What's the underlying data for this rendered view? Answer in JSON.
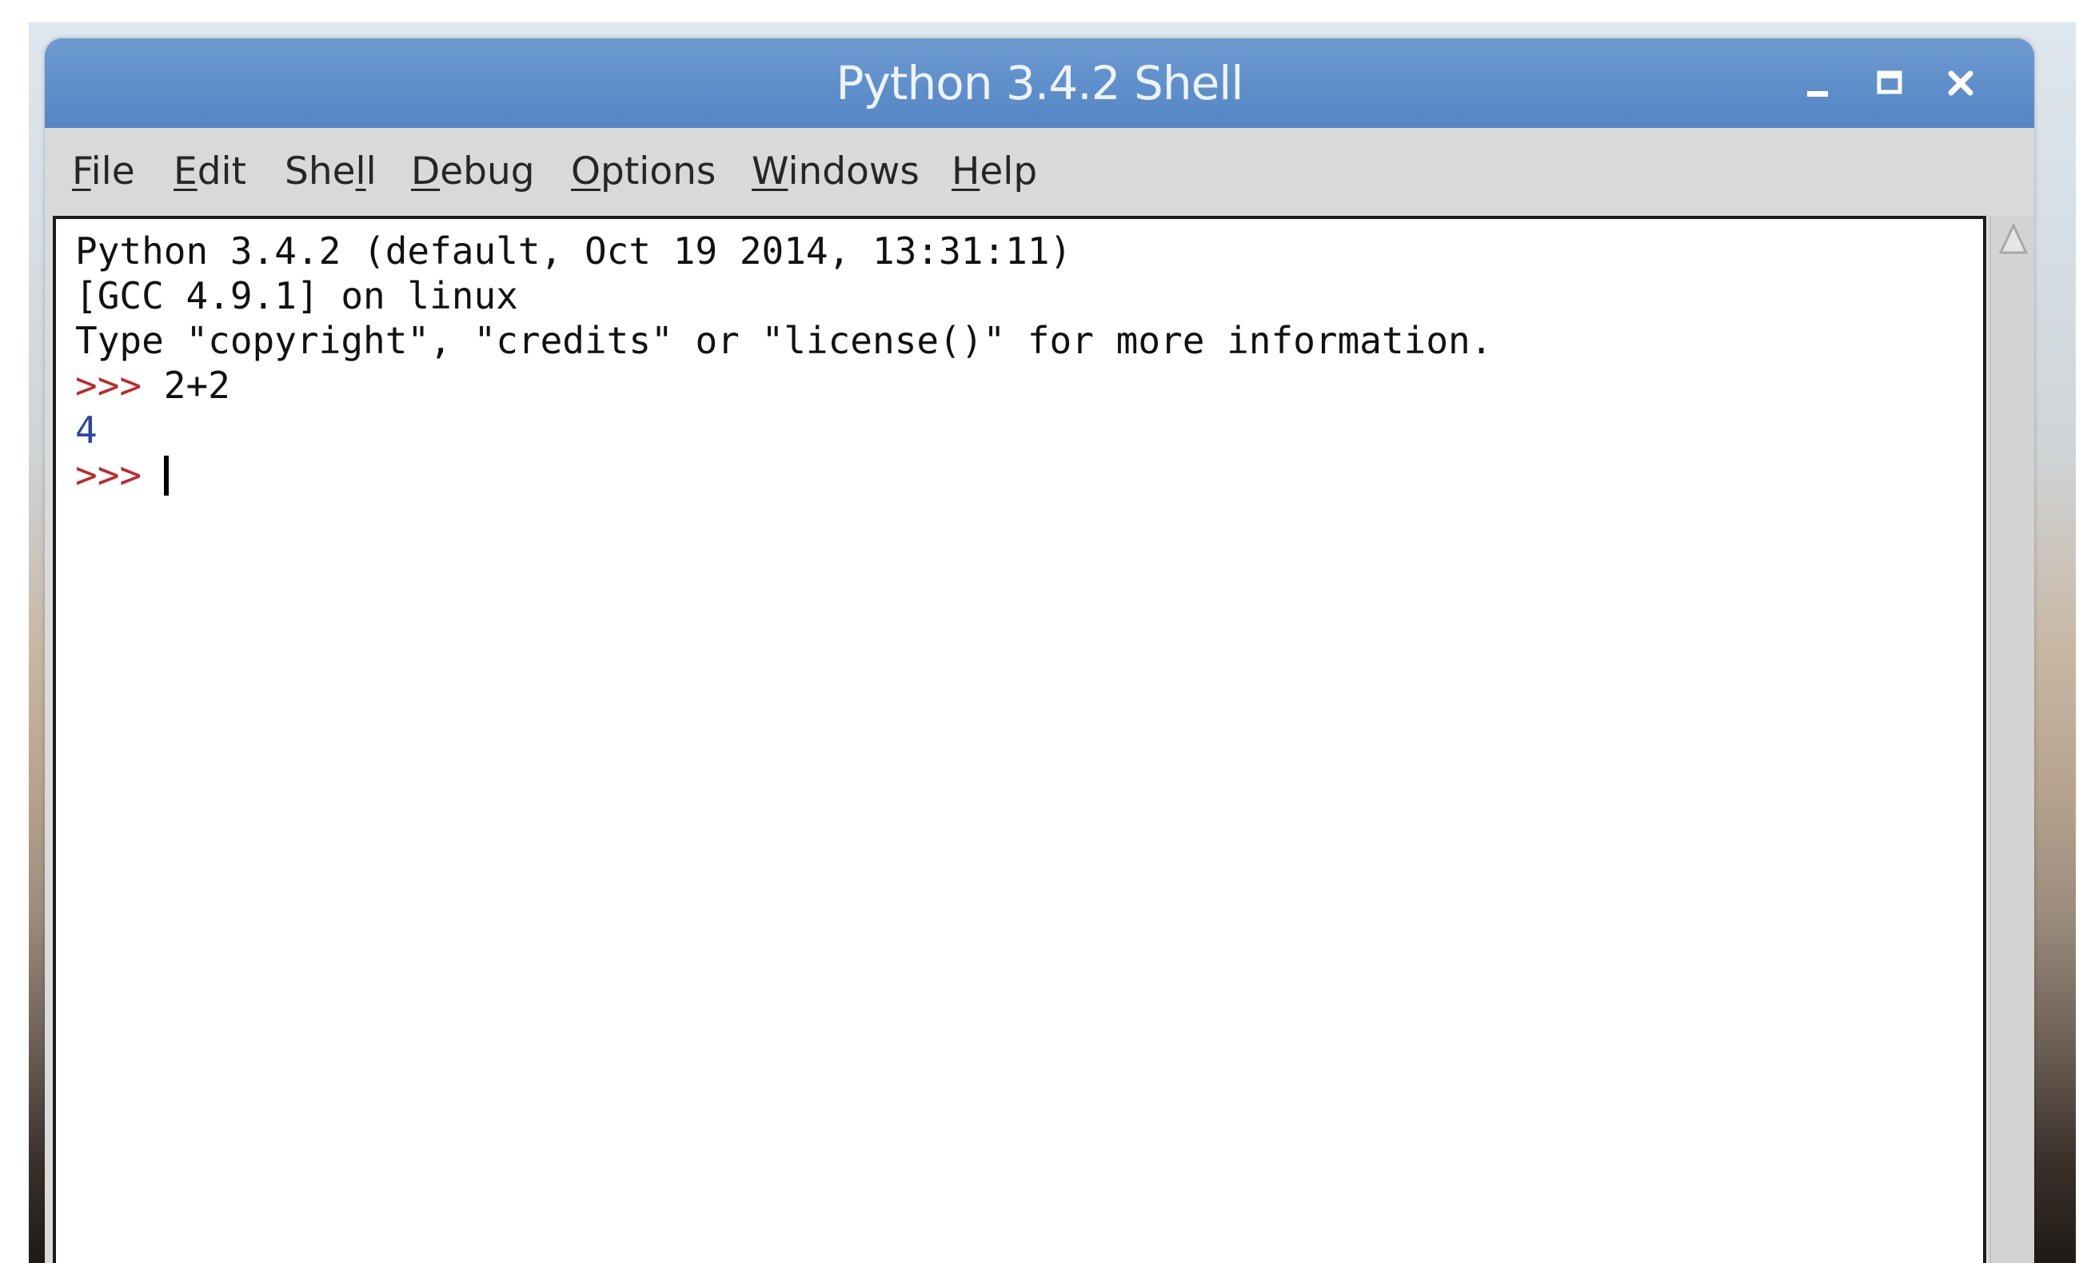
{
  "window": {
    "title": "Python 3.4.2 Shell",
    "titlebar_color": "#5f8fcb",
    "controls": {
      "minimize_icon": "minimize-icon",
      "maximize_icon": "maximize-icon",
      "close_icon": "close-icon"
    }
  },
  "menu": [
    {
      "pre": "",
      "accel": "F",
      "post": "ile"
    },
    {
      "pre": "",
      "accel": "E",
      "post": "dit"
    },
    {
      "pre": "She",
      "accel": "l",
      "post": "l"
    },
    {
      "pre": "",
      "accel": "D",
      "post": "ebug"
    },
    {
      "pre": "",
      "accel": "O",
      "post": "ptions"
    },
    {
      "pre": "",
      "accel": "W",
      "post": "indows"
    },
    {
      "pre": "",
      "accel": "H",
      "post": "elp"
    }
  ],
  "shell": {
    "banner": [
      "Python 3.4.2 (default, Oct 19 2014, 13:31:11)",
      "[GCC 4.9.1] on linux",
      "Type \"copyright\", \"credits\" or \"license()\" for more information."
    ],
    "prompt": ">>>",
    "input_1": "2+2",
    "output_1": "4",
    "prompt_color": "#c0282a",
    "output_color": "#2b47a8"
  },
  "scrollbar": {
    "up_arrow_icon": "scroll-up-arrow-icon"
  }
}
